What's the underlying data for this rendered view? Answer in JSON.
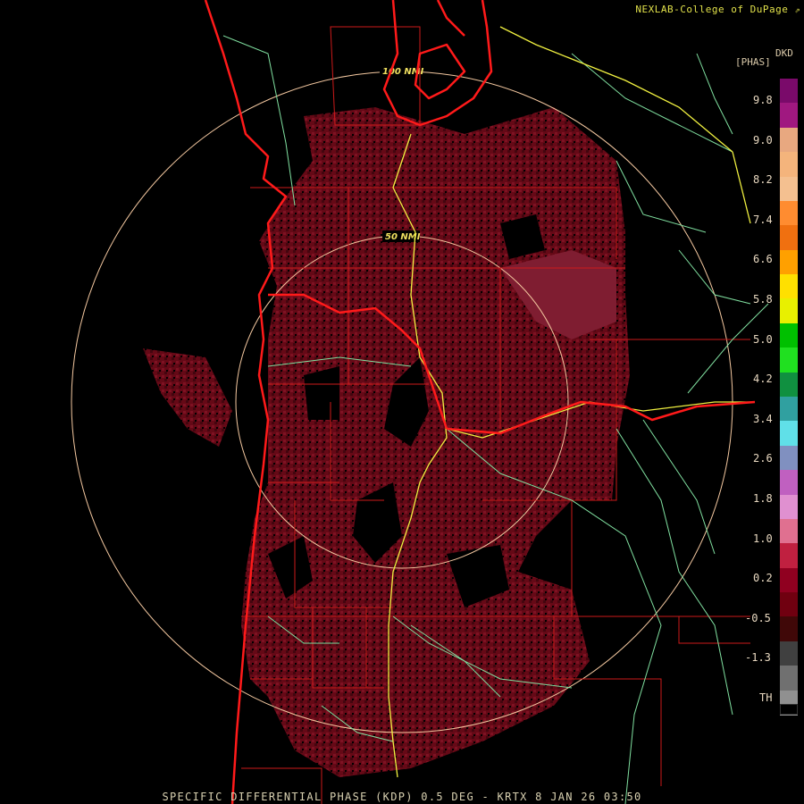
{
  "credit": "NEXLAB-College of DuPage",
  "credit_icon": "external-link-icon",
  "product_code": "DKD",
  "unit_label": "[PHAS]",
  "footer_title": "SPECIFIC DIFFERENTIAL PHASE (KDP) 0.5 DEG - KRTX 8 JAN 26 03:50",
  "range_rings": [
    {
      "label": "100 NMI"
    },
    {
      "label": "50 NMI"
    }
  ],
  "colorbar": {
    "tick_labels": [
      "9.8",
      "9.0",
      "8.2",
      "7.4",
      "6.6",
      "5.8",
      "5.0",
      "4.2",
      "3.4",
      "2.6",
      "1.8",
      "1.0",
      "0.2",
      "-0.5",
      "-1.3",
      "TH"
    ],
    "colors": [
      "#7a0a6a",
      "#a01880",
      "#e8a880",
      "#f4b47c",
      "#f4c090",
      "#ff8c30",
      "#f07010",
      "#ffa000",
      "#ffe000",
      "#e8f000",
      "#00c000",
      "#20e020",
      "#109040",
      "#30a0a0",
      "#60e0e8",
      "#8090c0",
      "#c060c0",
      "#e090d0",
      "#e07090",
      "#c02040",
      "#900020",
      "#700010",
      "#400808",
      "#404040",
      "#707070",
      "#909090"
    ]
  },
  "colors": {
    "coastline": "#ff1a1a",
    "county_border": "#cc1a1a",
    "highway": "#f0f040",
    "road": "#80e0a0",
    "range_ring": "#f4c8a0",
    "echo": "#7a0c1a"
  }
}
